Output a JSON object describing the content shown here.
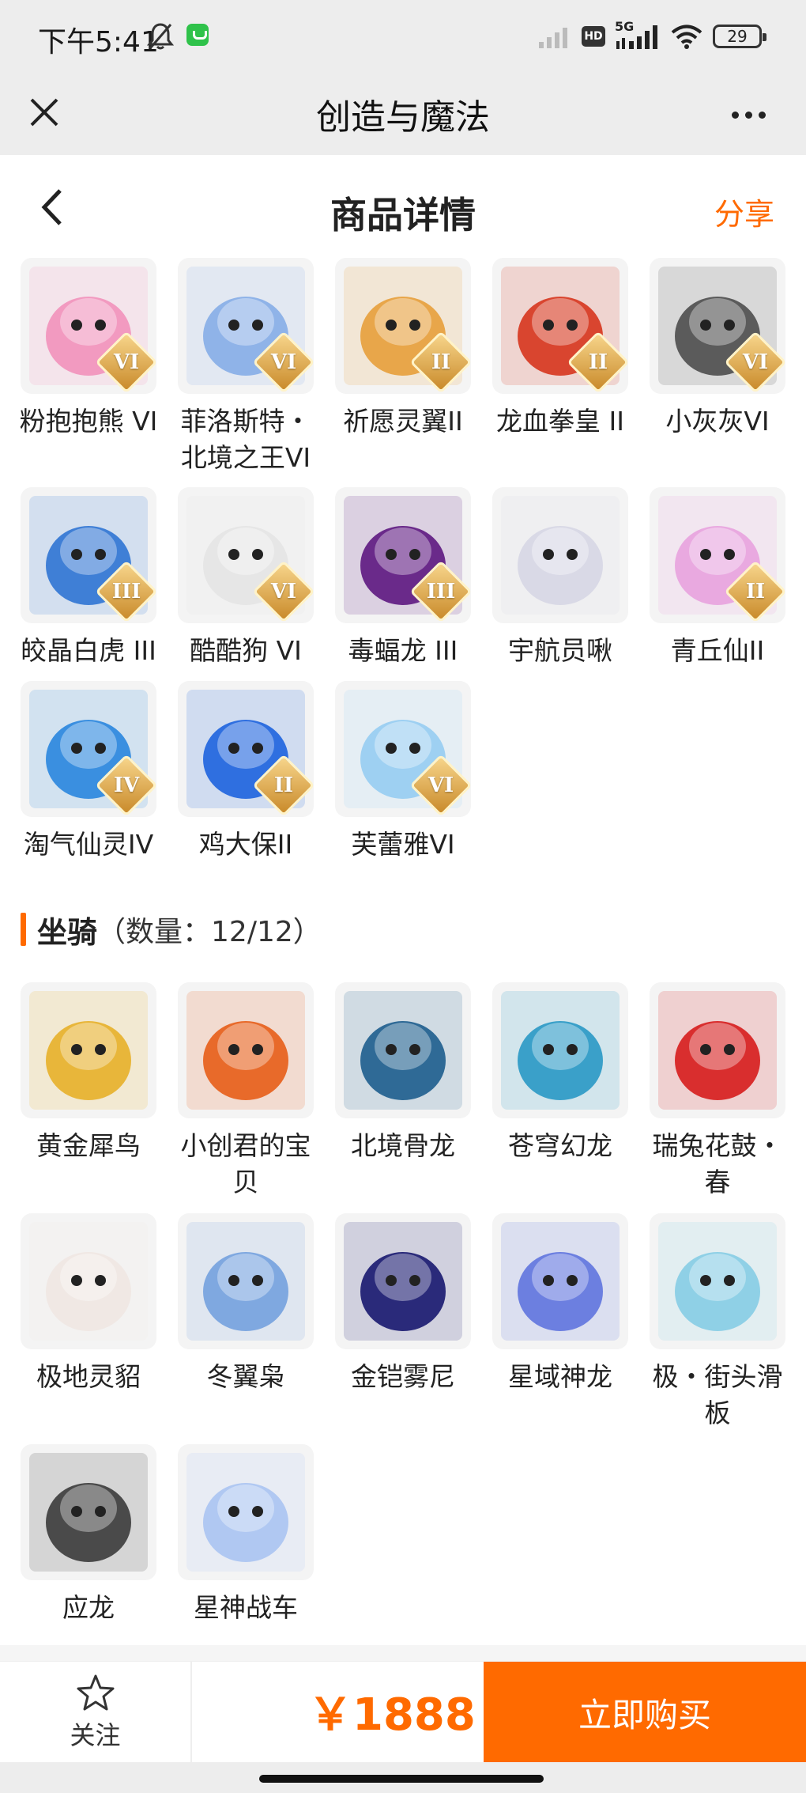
{
  "status_bar": {
    "time": "下午5:41",
    "network": "5G",
    "hd": "HD",
    "battery": "29"
  },
  "title_bar": {
    "title": "创造与魔法"
  },
  "page_header": {
    "title": "商品详情",
    "share": "分享"
  },
  "pets": [
    {
      "label": "粉抱抱熊 VI",
      "tier": "VI",
      "color": "#f29ac0"
    },
    {
      "label": "菲洛斯特・北境之王VI",
      "tier": "VI",
      "color": "#8fb3e8"
    },
    {
      "label": "祈愿灵翼II",
      "tier": "II",
      "color": "#e8a64a"
    },
    {
      "label": "龙血拳皇 II",
      "tier": "II",
      "color": "#d9452f"
    },
    {
      "label": "小灰灰VI",
      "tier": "VI",
      "color": "#5b5b5b"
    },
    {
      "label": "皎晶白虎 III",
      "tier": "III",
      "color": "#3f7fd6"
    },
    {
      "label": "酷酷狗 VI",
      "tier": "VI",
      "color": "#e6e6e6"
    },
    {
      "label": "毒蝠龙 III",
      "tier": "III",
      "color": "#6a2a8a"
    },
    {
      "label": "宇航员啾",
      "tier": "",
      "color": "#d9d9e6"
    },
    {
      "label": "青丘仙II",
      "tier": "II",
      "color": "#e9a9e0"
    },
    {
      "label": "淘气仙灵IV",
      "tier": "IV",
      "color": "#3a8fe0"
    },
    {
      "label": "鸡大保II",
      "tier": "II",
      "color": "#2f6fe0"
    },
    {
      "label": "芙蕾雅VI",
      "tier": "VI",
      "color": "#9ed0f2"
    }
  ],
  "mounts_section": {
    "name": "坐骑",
    "count": "（数量：12/12）"
  },
  "mounts": [
    {
      "label": "黄金犀鸟",
      "color": "#e8b63a"
    },
    {
      "label": "小创君的宝贝",
      "color": "#e86a2a"
    },
    {
      "label": "北境骨龙",
      "color": "#2f6a96"
    },
    {
      "label": "苍穹幻龙",
      "color": "#3aa0c9"
    },
    {
      "label": "瑞兔花鼓・春",
      "color": "#d92e2e"
    },
    {
      "label": "极地灵貂",
      "color": "#f0e8e4"
    },
    {
      "label": "冬翼枭",
      "color": "#7fa8e0"
    },
    {
      "label": "金铠雾尼",
      "color": "#2a2a7a"
    },
    {
      "label": "星域神龙",
      "color": "#6c7fe0"
    },
    {
      "label": "极・街头滑板",
      "color": "#8fd0e6"
    },
    {
      "label": "应龙",
      "color": "#4a4a4a"
    },
    {
      "label": "星神战车",
      "color": "#b0c8f2"
    }
  ],
  "bottom_bar": {
    "follow": "关注",
    "price": "￥1888",
    "buy": "立即购买"
  }
}
